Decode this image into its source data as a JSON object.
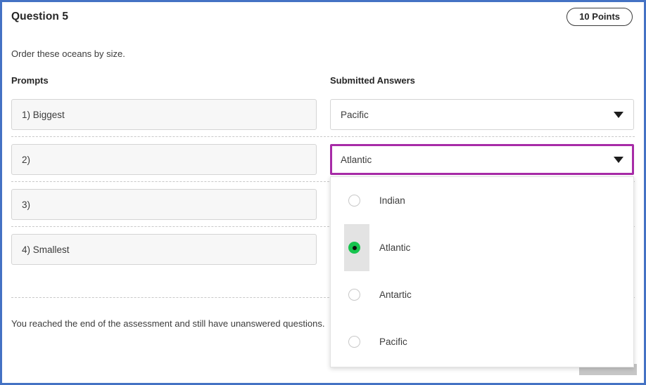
{
  "window": {
    "border_color": "#4472c4"
  },
  "header": {
    "title": "Question 5",
    "points_label": "10 Points"
  },
  "question": {
    "text": "Order these oceans by size."
  },
  "columns": {
    "prompts_heading": "Prompts",
    "answers_heading": "Submitted Answers"
  },
  "rows": [
    {
      "prompt": "1) Biggest",
      "answer": "Pacific",
      "focused": false
    },
    {
      "prompt": "2)",
      "answer": "Atlantic",
      "focused": true
    },
    {
      "prompt": "3)",
      "answer": "",
      "focused": false
    },
    {
      "prompt": "4) Smallest",
      "answer": "",
      "focused": false
    }
  ],
  "dropdown": {
    "open": true,
    "selected": "Atlantic",
    "focus_border_color": "#a72ba7",
    "selected_radio_color": "#16c44e",
    "options": [
      {
        "label": "Indian",
        "selected": false
      },
      {
        "label": "Atlantic",
        "selected": true
      },
      {
        "label": "Antartic",
        "selected": false
      },
      {
        "label": "Pacific",
        "selected": false
      }
    ]
  },
  "footer": {
    "note": "You reached the end of the assessment and still have unanswered questions."
  },
  "icons": {
    "caret_down": "chevron-down-icon"
  }
}
